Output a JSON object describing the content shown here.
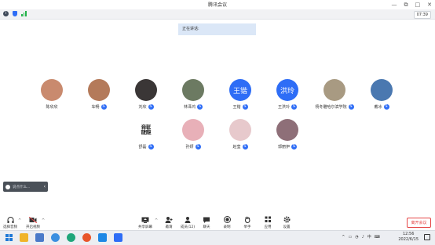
{
  "window": {
    "title": "腾讯会议",
    "controls": [
      "—",
      "⧉",
      "□",
      "✕"
    ]
  },
  "topbar": {
    "timer": "07:39"
  },
  "talking": {
    "label": "正在讲话:"
  },
  "participants": [
    {
      "name": "陈欣欣",
      "badge": "",
      "avatar_text": "",
      "color": "#c98a6e"
    },
    {
      "name": "车畅",
      "badge": "S",
      "avatar_text": "",
      "color": "#b47a5a"
    },
    {
      "name": "刘欣",
      "badge": "S",
      "avatar_text": "",
      "color": "#3a3636"
    },
    {
      "name": "林泽鸿",
      "badge": "S",
      "avatar_text": "",
      "color": "#6c7a62"
    },
    {
      "name": "王锴",
      "badge": "S",
      "avatar_text": "王锴",
      "color": "#2e6df6"
    },
    {
      "name": "王洪玲",
      "badge": "S",
      "avatar_text": "洪玲",
      "color": "#2e6df6"
    },
    {
      "name": "杨冬雕哈尔滨学院",
      "badge": "S",
      "avatar_text": "",
      "color": "#a89a82"
    },
    {
      "name": "戴冰",
      "badge": "S",
      "avatar_text": "",
      "color": "#4a78b0"
    },
    {
      "name": "舒磊",
      "badge": "S",
      "avatar_text": "龘",
      "color": "#ffffff"
    },
    {
      "name": "孙妍",
      "badge": "S",
      "avatar_text": "",
      "color": "#e8b0b8"
    },
    {
      "name": "赵莹",
      "badge": "S",
      "avatar_text": "",
      "color": "#e7c9cc"
    },
    {
      "name": "郭丽伊",
      "badge": "S",
      "avatar_text": "",
      "color": "#8e6f78"
    }
  ],
  "chat": {
    "placeholder": "说点什么...",
    "collapse": "‹"
  },
  "toolbar": {
    "left": [
      {
        "label": "选择音频",
        "icon": "headphones-icon"
      },
      {
        "label": "开启视频",
        "icon": "camera-icon"
      }
    ],
    "center": [
      {
        "label": "共享屏幕",
        "icon": "screen-share-icon"
      },
      {
        "label": "邀请",
        "icon": "invite-icon"
      },
      {
        "label": "成员(12)",
        "icon": "members-icon"
      },
      {
        "label": "聊天",
        "icon": "chat-icon"
      },
      {
        "label": "录制",
        "icon": "record-icon"
      },
      {
        "label": "举手",
        "icon": "raise-hand-icon"
      },
      {
        "label": "应用",
        "icon": "apps-icon"
      },
      {
        "label": "设置",
        "icon": "gear-icon"
      }
    ],
    "leave": "离开会议"
  },
  "taskbar": {
    "clock_time": "12:56",
    "clock_date": "2022/6/15",
    "tray": [
      "^",
      "▭",
      "◔",
      "♪",
      "中",
      "⌨"
    ]
  }
}
